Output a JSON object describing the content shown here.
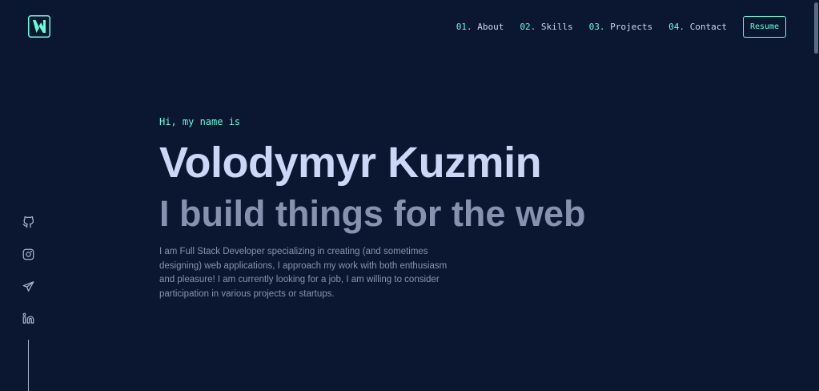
{
  "header": {
    "logo_icon": "vk-monogram-logo",
    "nav": [
      {
        "num": "01.",
        "label": "About"
      },
      {
        "num": "02.",
        "label": "Skills"
      },
      {
        "num": "03.",
        "label": "Projects"
      },
      {
        "num": "04.",
        "label": "Contact"
      }
    ],
    "resume_label": "Resume"
  },
  "social": [
    {
      "icon": "github-icon"
    },
    {
      "icon": "instagram-icon"
    },
    {
      "icon": "telegram-icon"
    },
    {
      "icon": "linkedin-icon"
    }
  ],
  "hero": {
    "greeting": "Hi, my name is",
    "name": "Volodymyr Kuzmin",
    "tagline": "I build things for the web",
    "bio": "I am Full Stack Developer specializing in creating (and sometimes designing) web applications, I approach my work with both enthusiasm and pleasure! I am currently looking for a job, I am willing to consider participation in various projects or startups."
  },
  "colors": {
    "background": "#0b1730",
    "accent": "#64ffda",
    "heading": "#ccd6f6",
    "text": "#8892b0"
  }
}
